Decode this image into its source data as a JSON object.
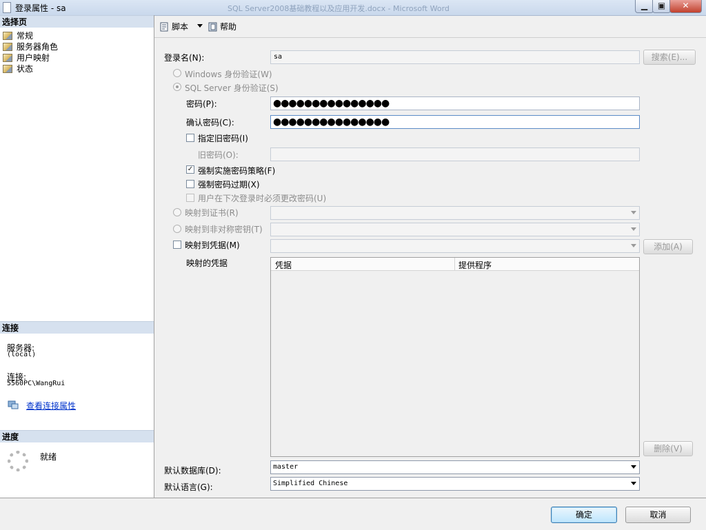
{
  "window": {
    "title": "登录属性 - sa",
    "background_title": "SQL Server2008基础教程以及应用开发.docx - Microsoft Word",
    "minimize_icon": "minimize-icon",
    "maximize_icon": "maximize-icon",
    "close_icon": "close-icon"
  },
  "left_pane": {
    "select_page_header": "选择页",
    "pages": [
      {
        "label": "常规",
        "icon": "page-icon"
      },
      {
        "label": "服务器角色",
        "icon": "page-icon"
      },
      {
        "label": "用户映射",
        "icon": "page-icon"
      },
      {
        "label": "状态",
        "icon": "page-icon"
      }
    ],
    "connection_header": "连接",
    "server_label": "服务器:",
    "server_value": "(local)",
    "connection_label": "连接:",
    "connection_value": "5560PC\\WangRui",
    "view_connection_link": "查看连接属性",
    "progress_header": "进度",
    "progress_status": "就绪"
  },
  "toolbar": {
    "script_label": "脚本",
    "help_label": "帮助"
  },
  "form": {
    "login_name_label": "登录名(N):",
    "login_name_value": "sa",
    "search_button": "搜索(E)...",
    "windows_auth": "Windows 身份验证(W)",
    "sql_auth": "SQL Server 身份验证(S)",
    "password_label": "密码(P):",
    "password_value": "●●●●●●●●●●●●●●●",
    "confirm_password_label": "确认密码(C):",
    "confirm_password_value": "●●●●●●●●●●●●●●●",
    "specify_old_password": "指定旧密码(I)",
    "old_password_label": "旧密码(O):",
    "enforce_policy": "强制实施密码策略(F)",
    "enforce_expiration": "强制密码过期(X)",
    "must_change": "用户在下次登录时必须更改密码(U)",
    "map_certificate": "映射到证书(R)",
    "map_asymmetric_key": "映射到非对称密钥(T)",
    "map_credential": "映射到凭据(M)",
    "add_button": "添加(A)",
    "mapped_credentials_label": "映射的凭据",
    "grid_col_credential": "凭据",
    "grid_col_provider": "提供程序",
    "remove_button": "删除(V)",
    "default_db_label": "默认数据库(D):",
    "default_db_value": "master",
    "default_lang_label": "默认语言(G):",
    "default_lang_value": "Simplified Chinese"
  },
  "footer": {
    "ok_button": "确定",
    "cancel_button": "取消"
  }
}
